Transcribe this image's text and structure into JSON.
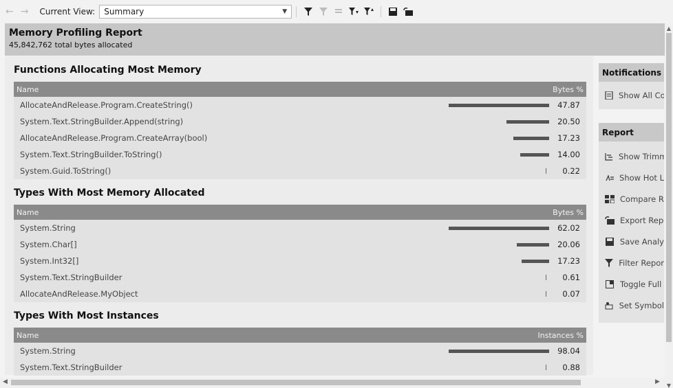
{
  "toolbar": {
    "current_view_label": "Current View:",
    "current_view_value": "Summary"
  },
  "report": {
    "title": "Memory Profiling Report",
    "subtitle": "45,842,762 total bytes allocated"
  },
  "sections": [
    {
      "title": "Functions Allocating Most Memory",
      "col_name": "Name",
      "col_value": "Bytes %",
      "rows": [
        {
          "name": "AllocateAndRelease.Program.CreateString()",
          "value": "47.87",
          "pct": 47.87
        },
        {
          "name": "System.Text.StringBuilder.Append(string)",
          "value": "20.50",
          "pct": 20.5
        },
        {
          "name": "AllocateAndRelease.Program.CreateArray(bool)",
          "value": "17.23",
          "pct": 17.23
        },
        {
          "name": "System.Text.StringBuilder.ToString()",
          "value": "14.00",
          "pct": 14.0
        },
        {
          "name": "System.Guid.ToString()",
          "value": "0.22",
          "pct": 0.22
        }
      ]
    },
    {
      "title": "Types With Most Memory Allocated",
      "col_name": "Name",
      "col_value": "Bytes %",
      "rows": [
        {
          "name": "System.String",
          "value": "62.02",
          "pct": 62.02
        },
        {
          "name": "System.Char[]",
          "value": "20.06",
          "pct": 20.06
        },
        {
          "name": "System.Int32[]",
          "value": "17.23",
          "pct": 17.23
        },
        {
          "name": "System.Text.StringBuilder",
          "value": "0.61",
          "pct": 0.61
        },
        {
          "name": "AllocateAndRelease.MyObject",
          "value": "0.07",
          "pct": 0.07
        }
      ]
    },
    {
      "title": "Types With Most Instances",
      "col_name": "Name",
      "col_value": "Instances %",
      "rows": [
        {
          "name": "System.String",
          "value": "98.04",
          "pct": 98.04
        },
        {
          "name": "System.Text.StringBuilder",
          "value": "0.88",
          "pct": 0.88
        }
      ]
    }
  ],
  "notifications": {
    "title": "Notifications",
    "items": [
      {
        "label": "Show All Co",
        "icon": "notifications-icon"
      }
    ]
  },
  "report_panel": {
    "title": "Report",
    "items": [
      {
        "label": "Show Trimm",
        "icon": "trim-icon"
      },
      {
        "label": "Show Hot L",
        "icon": "hot-path-icon"
      },
      {
        "label": "Compare R",
        "icon": "compare-icon"
      },
      {
        "label": "Export Repo",
        "icon": "export-icon"
      },
      {
        "label": "Save Analy",
        "icon": "save-icon"
      },
      {
        "label": "Filter Repor",
        "icon": "filter-icon"
      },
      {
        "label": "Toggle Full",
        "icon": "fullscreen-icon"
      },
      {
        "label": "Set Symbol",
        "icon": "symbol-icon"
      }
    ]
  }
}
